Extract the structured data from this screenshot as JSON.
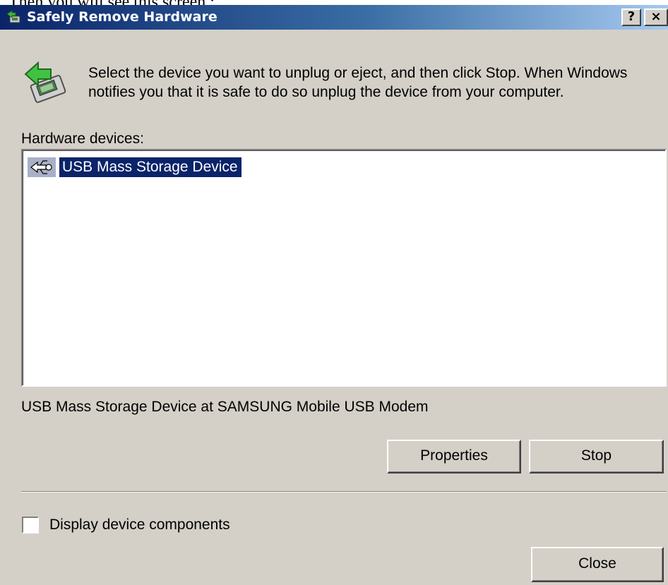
{
  "page_caption": "Then you will see this screen :",
  "window": {
    "title": "Safely Remove Hardware",
    "help_button": "?",
    "close_button": "×"
  },
  "instructions": "Select the device you want to unplug or eject, and then click Stop. When Windows notifies you that it is safe to do so unplug the device from your computer.",
  "hardware_devices_label": "Hardware devices:",
  "devices": [
    {
      "label": "USB Mass Storage Device",
      "icon": "usb-icon",
      "selected": true
    }
  ],
  "device_status": "USB Mass Storage Device at SAMSUNG Mobile USB Modem",
  "buttons": {
    "properties": "Properties",
    "stop": "Stop",
    "close": "Close"
  },
  "display_components": {
    "label": "Display device components",
    "checked": false
  },
  "colors": {
    "dialog_background": "#d4d0c8",
    "titlebar_start": "#0a246a",
    "titlebar_end": "#a6caf0",
    "selection": "#0a246a"
  }
}
